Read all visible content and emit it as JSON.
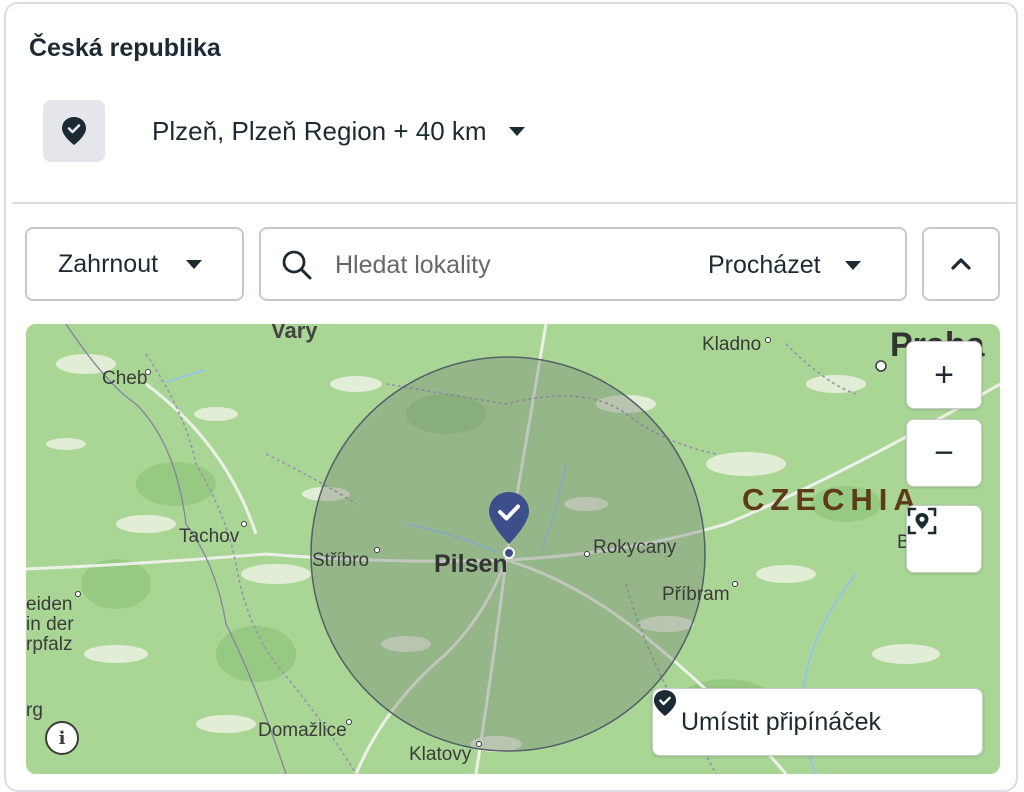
{
  "header": {
    "country": "Česká republika",
    "location_label": "Plzeň, Plzeň Region + 40 km",
    "location_icon": "location-pin-check-icon"
  },
  "toolbar": {
    "include_label": "Zahrnout",
    "search_placeholder": "Hledat lokality",
    "search_value": "",
    "browse_label": "Procházet"
  },
  "map": {
    "labels": {
      "vary": "Vary",
      "cheb": "Cheb",
      "kladno": "Kladno",
      "praha": "Praha",
      "czechia": "CZECHIA",
      "tachov": "Tachov",
      "stribro": "Stříbro",
      "pilsen": "Pilsen",
      "rokycany": "Rokycany",
      "pribram": "Příbram",
      "eiden": "eiden",
      "in_der": "in der",
      "rpfalz": "rpfalz",
      "rg": "rg",
      "domazlice": "Domažlice",
      "klatovy": "Klatovy",
      "b_edge": "B"
    },
    "radius_km": 40,
    "colors": {
      "land": "#a9d695",
      "radius_fill": "#7a8a7a",
      "pin": "#3d4f8a",
      "czechia_label": "#5c3a1a"
    },
    "controls": {
      "zoom_in": "+",
      "zoom_out": "−",
      "place_pin_label": "Umístit připínáček",
      "info": "i"
    }
  }
}
